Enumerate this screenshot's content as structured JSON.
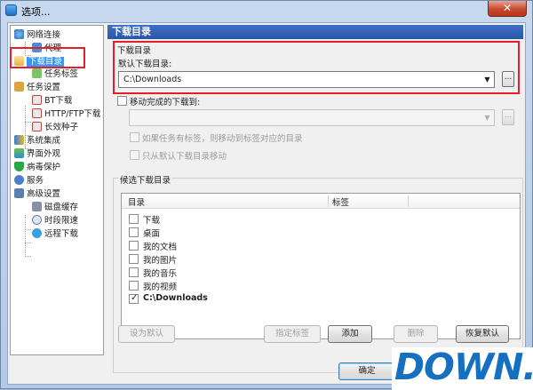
{
  "window": {
    "title": "选项...",
    "close_glyph": "✕"
  },
  "tree": {
    "items": [
      {
        "label": "网络连接",
        "icon": "network-icon"
      },
      {
        "label": "代理",
        "icon": "proxy-icon"
      },
      {
        "label": "下载目录",
        "icon": "folder-icon",
        "selected": true
      },
      {
        "label": "任务标签",
        "icon": "tag-icon"
      },
      {
        "label": "任务设置",
        "icon": "task-settings-icon"
      },
      {
        "label": "BT下载",
        "icon": "bt-icon"
      },
      {
        "label": "HTTP/FTP下载",
        "icon": "http-icon"
      },
      {
        "label": "长效种子",
        "icon": "seed-icon"
      },
      {
        "label": "系统集成",
        "icon": "integration-icon"
      },
      {
        "label": "界面外观",
        "icon": "appearance-icon"
      },
      {
        "label": "病毒保护",
        "icon": "shield-icon"
      },
      {
        "label": "服务",
        "icon": "service-icon"
      },
      {
        "label": "高级设置",
        "icon": "advanced-icon"
      },
      {
        "label": "磁盘缓存",
        "icon": "disk-icon"
      },
      {
        "label": "时段限速",
        "icon": "clock-icon"
      },
      {
        "label": "远程下载",
        "icon": "remote-icon"
      }
    ]
  },
  "panel": {
    "header": "下载目录",
    "section_title": "下载目录",
    "default_dir_label": "默认下载目录:",
    "default_dir_value": "C:\\Downloads",
    "browse_label": "...",
    "move_completed_label": "移动完成的下载到:",
    "move_completed_checked": false,
    "move_completed_value": "",
    "tag_option_label": "如果任务有标签，则移动到标签对应的目录",
    "only_default_label": "只从默认下载目录移动"
  },
  "candidates": {
    "title": "候选下载目录",
    "columns": [
      "目录",
      "标签"
    ],
    "rows": [
      {
        "label": "下载",
        "checked": false
      },
      {
        "label": "桌面",
        "checked": false
      },
      {
        "label": "我的文档",
        "checked": false
      },
      {
        "label": "我的图片",
        "checked": false
      },
      {
        "label": "我的音乐",
        "checked": false
      },
      {
        "label": "我的视频",
        "checked": false
      },
      {
        "label": "C:\\Downloads",
        "checked": true
      }
    ]
  },
  "buttons": {
    "set_default": "设为默认",
    "assign_tag": "指定标签",
    "add": "添加",
    "delete": "删除",
    "restore_default": "恢复默认",
    "ok": "确定"
  },
  "watermark": "DOWN.cc",
  "colors": {
    "accent": "#2a56a8",
    "highlight": "#e41e2a",
    "selection": "#3399ff"
  }
}
